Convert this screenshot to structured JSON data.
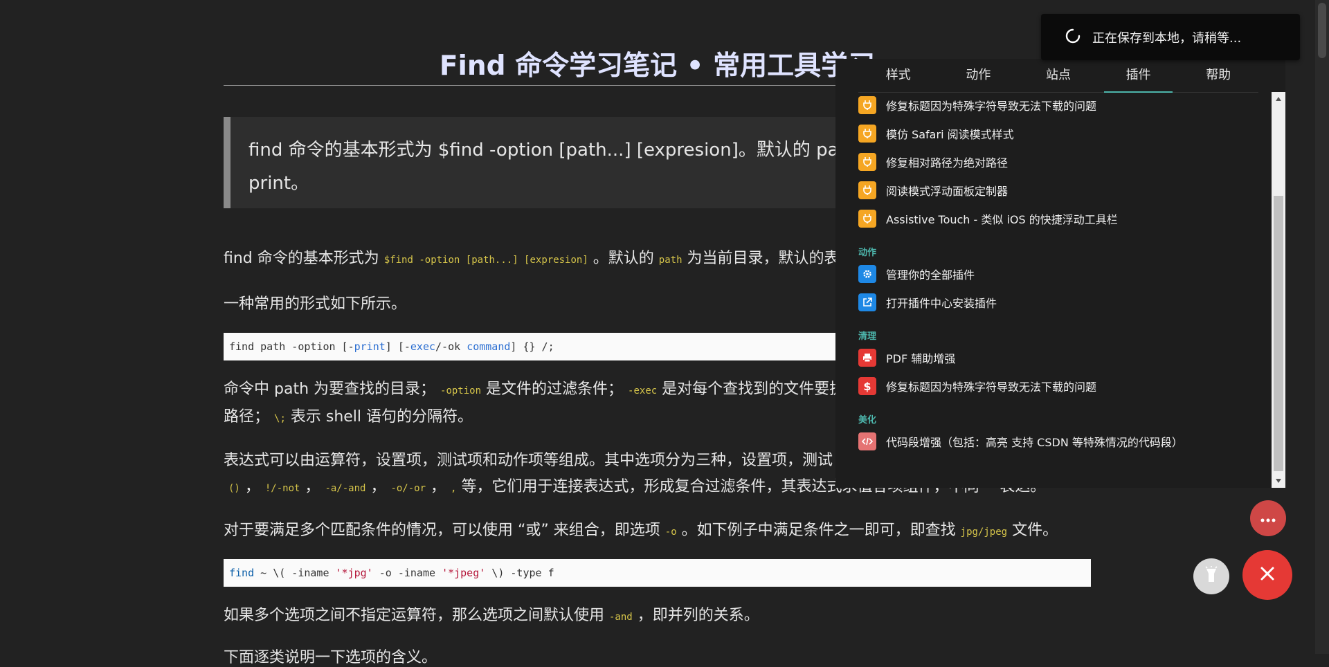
{
  "article": {
    "title": "Find 命令学习笔记 • 常用工具学习",
    "blockquote": "find 命令的基本形式为 $find -option [path...] [expresion]。默认的 path 为",
    "blockquote_line2": "print。",
    "p1_a": "find 命令的基本形式为 ",
    "p1_code1": "$find -option [path...] [expresion]",
    "p1_b": " 。默认的 ",
    "p1_code2": "path",
    "p1_c": " 为当前目录，默认的表",
    "p2": "一种常用的形式如下所示。",
    "code1": {
      "a": "find path -option [-",
      "b": "print",
      "c": "] [-",
      "d": "exec",
      "e": "/-ok ",
      "f": "command",
      "g": "] {} /;"
    },
    "p3_a": "命令中 path 为要查找的目录；",
    "p3_code1": "-option",
    "p3_b": " 是文件的过滤条件；",
    "p3_code2": "-exec",
    "p3_c": " 是对每个查找到的文件要执",
    "p3_line2_a": "路径；",
    "p3_code3": "\\;",
    "p3_line2_b": " 表示 shell 语句的分隔符。",
    "p4_line1": "表达式可以由运算符，设置项，测试项和动作项等组成。其中选项分为三种，设置项，测试",
    "p4_code1": "()",
    "p4_code2": "!/-not",
    "p4_code3": "-a/-and",
    "p4_code4": "-o/-or",
    "p4_code5": ",",
    "p4_sep": " ，",
    "p4_tail": " 等，它们用于连接表达式，形成复合过滤条件，其表达式求值各项组件，不同 -- 表达。",
    "p5_a": "对于要满足多个匹配条件的情况，可以使用 “或” 来组合，即选项 ",
    "p5_code1": "-o",
    "p5_b": " 。如下例子中满足条件之一即可，即查找 ",
    "p5_code2": "jpg/jpeg",
    "p5_c": " 文件。",
    "code2": {
      "a": "find",
      "b": " ~ \\( -iname ",
      "c": "'*jpg'",
      "d": " -o -iname ",
      "e": "'*jpeg'",
      "f": " \\) -type f"
    },
    "p6_a": "如果多个选项之间不指定运算符，那么选项之间默认使用 ",
    "p6_code1": "-and",
    "p6_b": " ，即并列的关系。",
    "p7": "下面逐类说明一下选项的含义。"
  },
  "panel": {
    "tabs": [
      "样式",
      "动作",
      "站点",
      "插件",
      "帮助"
    ],
    "active_tab": 3,
    "items_top": [
      {
        "label": "修复标题因为特殊字符导致无法下载的问题",
        "icon": "plug-icon",
        "color": "#f5a623"
      },
      {
        "label": "模仿 Safari 阅读模式样式",
        "icon": "plug-icon",
        "color": "#f5a623"
      },
      {
        "label": "修复相对路径为绝对路径",
        "icon": "plug-icon",
        "color": "#f5a623"
      },
      {
        "label": "阅读模式浮动面板定制器",
        "icon": "plug-icon",
        "color": "#f5a623"
      },
      {
        "label": "Assistive Touch - 类似 iOS 的快捷浮动工具栏",
        "icon": "plug-icon",
        "color": "#f5a623"
      }
    ],
    "section_action": "动作",
    "items_action": [
      {
        "label": "管理你的全部插件",
        "icon": "gear-icon",
        "color": "#1e88e5"
      },
      {
        "label": "打开插件中心安装插件",
        "icon": "external-link-icon",
        "color": "#1e88e5"
      }
    ],
    "section_clean": "清理",
    "items_clean": [
      {
        "label": "PDF 辅助增强",
        "icon": "printer-icon",
        "color": "#e53935"
      },
      {
        "label": "修复标题因为特殊字符导致无法下载的问题",
        "icon": "dollar-icon",
        "color": "#e53935"
      }
    ],
    "section_beauty": "美化",
    "items_beauty": [
      {
        "label": "代码段增强（包括：高亮 支持 CSDN 等特殊情况的代码段）",
        "icon": "code-icon",
        "color": "#e57373"
      }
    ]
  },
  "toast": {
    "message": "正在保存到本地，请稍等..."
  },
  "colors": {
    "background": "#222222",
    "accent": "#4db6ac",
    "fab_red": "#e53935"
  }
}
